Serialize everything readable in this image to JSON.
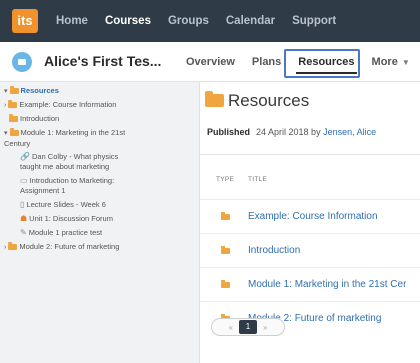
{
  "top_nav": {
    "logo": "its",
    "items": [
      {
        "label": "Home"
      },
      {
        "label": "Courses"
      },
      {
        "label": "Groups"
      },
      {
        "label": "Calendar"
      },
      {
        "label": "Support"
      }
    ],
    "active": "Courses"
  },
  "course": {
    "title": "Alice's First Tes...",
    "tabs": [
      {
        "label": "Overview"
      },
      {
        "label": "Plans"
      },
      {
        "label": "Resources"
      },
      {
        "label": "More"
      }
    ],
    "active_tab": "Resources"
  },
  "sidebar": {
    "items": [
      {
        "label": "Resources",
        "icon": "folder-icon",
        "expanded": true
      },
      {
        "label": "Example: Course Information",
        "icon": "folder-icon"
      },
      {
        "label": "Introduction",
        "icon": "folder-icon"
      },
      {
        "label": "Module 1: Marketing in the 21st Century",
        "icon": "folder-icon",
        "expanded": true
      },
      {
        "label": "Dan Colby - What physics taught me about marketing",
        "icon": "link-icon"
      },
      {
        "label": "Introduction to Marketing: Assignment 1",
        "icon": "assignment-icon"
      },
      {
        "label": "Lecture Slides - Week 6",
        "icon": "document-icon"
      },
      {
        "label": "Unit 1: Discussion Forum",
        "icon": "forum-icon"
      },
      {
        "label": "Module 1 practice test",
        "icon": "test-icon"
      },
      {
        "label": "Module 2: Future of marketing",
        "icon": "folder-icon"
      }
    ]
  },
  "main": {
    "title": "Resources",
    "status": "Published",
    "date_text": "24 April 2018 by",
    "author": "Jensen, Alice",
    "columns": {
      "type": "TYPE",
      "title": "TITLE"
    },
    "rows": [
      {
        "type_icon": "folder-icon",
        "title": "Example: Course Information"
      },
      {
        "type_icon": "folder-icon",
        "title": "Introduction"
      },
      {
        "type_icon": "folder-icon",
        "title": "Module 1: Marketing in the 21st Cer"
      },
      {
        "type_icon": "folder-icon",
        "title": "Module 2: Future of marketing"
      }
    ],
    "pagination": {
      "prev": "«",
      "current": "1",
      "next": "»"
    }
  },
  "colors": {
    "topbar": "#2f3b47",
    "logo": "#f0922e",
    "folder": "#f0a640",
    "link": "#2f6fb0",
    "highlight": "#4a78c7"
  }
}
